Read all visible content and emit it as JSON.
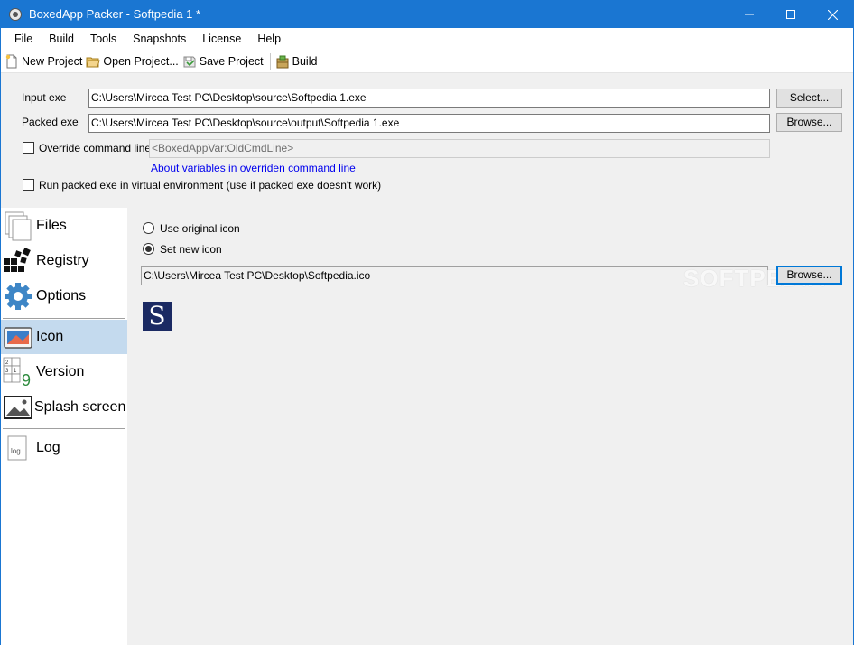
{
  "window": {
    "title": "BoxedApp Packer - Softpedia 1 *",
    "accent": "#1a76d2"
  },
  "menu": [
    "File",
    "Build",
    "Tools",
    "Snapshots",
    "License",
    "Help"
  ],
  "toolbar": {
    "new_project": "New Project",
    "open_project": "Open Project...",
    "save_project": "Save Project",
    "build": "Build"
  },
  "form": {
    "input_exe_label": "Input exe",
    "input_exe_value": "C:\\Users\\Mircea Test PC\\Desktop\\source\\Softpedia 1.exe",
    "select_button": "Select...",
    "packed_exe_label": "Packed exe",
    "packed_exe_value": "C:\\Users\\Mircea Test PC\\Desktop\\source\\output\\Softpedia 1.exe",
    "browse_button": "Browse...",
    "override_label": "Override command line",
    "override_value": "<BoxedAppVar:OldCmdLine>",
    "override_checked": false,
    "variables_link": "About variables in overriden command line",
    "virtual_env_label": "Run packed exe in virtual environment (use if packed exe doesn't work)",
    "virtual_env_checked": false
  },
  "sidebar": {
    "items": [
      {
        "label": "Files",
        "icon": "files-icon"
      },
      {
        "label": "Registry",
        "icon": "registry-icon"
      },
      {
        "label": "Options",
        "icon": "gear-icon"
      },
      {
        "label": "Icon",
        "icon": "icon-icon",
        "selected": true
      },
      {
        "label": "Version",
        "icon": "version-icon"
      },
      {
        "label": "Splash screen",
        "icon": "splash-icon"
      },
      {
        "label": "Log",
        "icon": "log-icon"
      }
    ],
    "selected_color": "#c4daee"
  },
  "icon_panel": {
    "use_original_label": "Use original icon",
    "set_new_label": "Set new icon",
    "selected_option": "Set new icon",
    "icon_path": "C:\\Users\\Mircea Test PC\\Desktop\\Softpedia.ico",
    "browse_button": "Browse...",
    "preview_letter": "S"
  },
  "watermark": "SOFTPEDIA"
}
